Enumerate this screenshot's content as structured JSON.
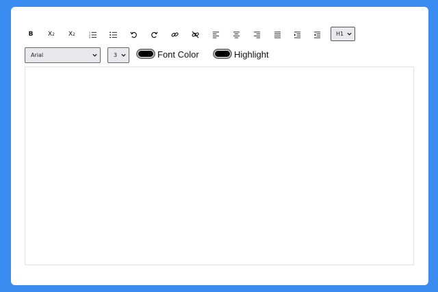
{
  "toolbar": {
    "bold_label": "B",
    "superscript_label": "X",
    "superscript_mark": "2",
    "subscript_label": "X",
    "subscript_mark": "2",
    "icons": [
      "bold",
      "superscript",
      "subscript",
      "ordered-list-icon",
      "unordered-list-icon",
      "undo-icon",
      "redo-icon",
      "link-icon",
      "unlink-icon",
      "align-left-icon",
      "align-center-icon",
      "align-right-icon",
      "align-justify-icon",
      "indent-icon",
      "outdent-icon"
    ],
    "heading_value": "H1"
  },
  "format": {
    "font_value": "Arial",
    "size_value": "3",
    "font_color_label": "Font Color",
    "font_color": "#000000",
    "highlight_label": "Highlight",
    "highlight_color": "#000000"
  },
  "editor": {
    "content": ""
  },
  "colors": {
    "background": "#3b8cf0",
    "card": "#ffffff"
  }
}
